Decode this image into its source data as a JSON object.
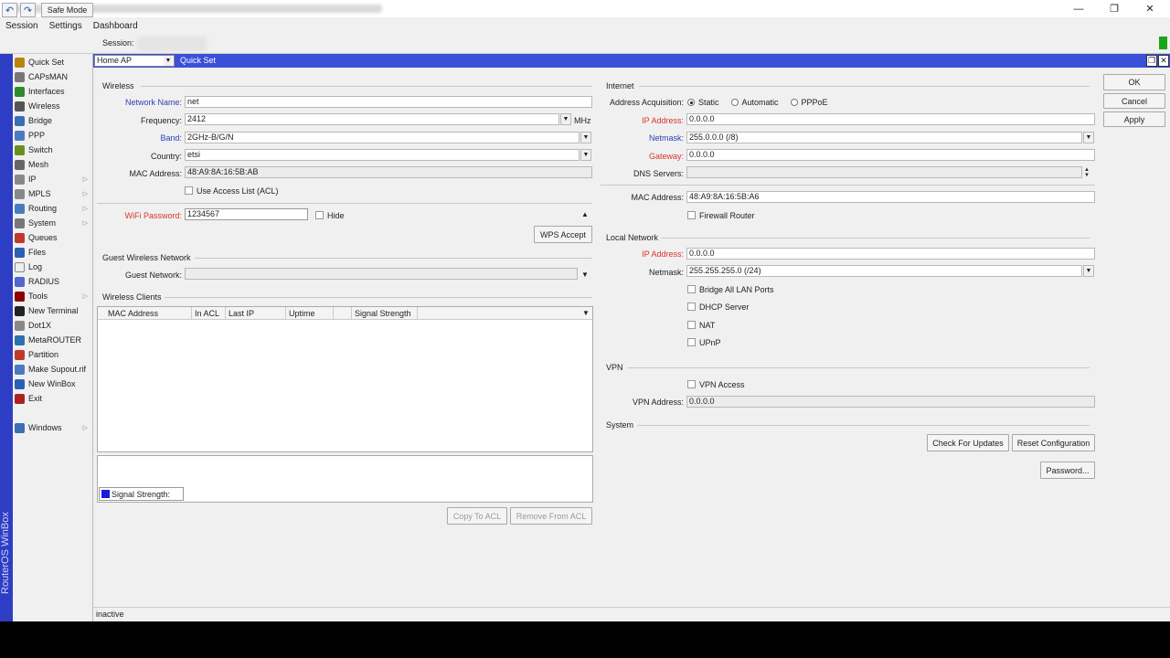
{
  "menu": [
    "Session",
    "Settings",
    "Dashboard"
  ],
  "toolbar": {
    "safe_mode": "Safe Mode",
    "session_label": "Session:"
  },
  "window_controls": {
    "minimize": "—",
    "maximize": "❐",
    "close": "✕"
  },
  "sidebar": {
    "vertical_label": "RouterOS WinBox",
    "items": [
      {
        "label": "Quick Set",
        "icon": "wand-icon",
        "color": "#b8860b",
        "sub": false
      },
      {
        "label": "CAPsMAN",
        "icon": "capsman-icon",
        "color": "#777777",
        "sub": false
      },
      {
        "label": "Interfaces",
        "icon": "interfaces-icon",
        "color": "#2e8b2e",
        "sub": false
      },
      {
        "label": "Wireless",
        "icon": "wireless-icon",
        "color": "#555555",
        "sub": false
      },
      {
        "label": "Bridge",
        "icon": "bridge-icon",
        "color": "#3a6fb0",
        "sub": false
      },
      {
        "label": "PPP",
        "icon": "ppp-icon",
        "color": "#4a7ac0",
        "sub": false
      },
      {
        "label": "Switch",
        "icon": "switch-icon",
        "color": "#6b8e23",
        "sub": false
      },
      {
        "label": "Mesh",
        "icon": "mesh-icon",
        "color": "#666666",
        "sub": false
      },
      {
        "label": "IP",
        "icon": "ip-icon",
        "color": "#888888",
        "sub": true
      },
      {
        "label": "MPLS",
        "icon": "mpls-icon",
        "color": "#888888",
        "sub": true
      },
      {
        "label": "Routing",
        "icon": "routing-icon",
        "color": "#4a7ac0",
        "sub": true
      },
      {
        "label": "System",
        "icon": "system-icon",
        "color": "#777777",
        "sub": true
      },
      {
        "label": "Queues",
        "icon": "queues-icon",
        "color": "#c0392b",
        "sub": false
      },
      {
        "label": "Files",
        "icon": "files-icon",
        "color": "#2b5fb4",
        "sub": false
      },
      {
        "label": "Log",
        "icon": "log-icon",
        "color": "#eeeeee",
        "sub": false
      },
      {
        "label": "RADIUS",
        "icon": "radius-icon",
        "color": "#5566cc",
        "sub": false
      },
      {
        "label": "Tools",
        "icon": "tools-icon",
        "color": "#8b0000",
        "sub": true
      },
      {
        "label": "New Terminal",
        "icon": "terminal-icon",
        "color": "#222222",
        "sub": false
      },
      {
        "label": "Dot1X",
        "icon": "dot1x-icon",
        "color": "#888888",
        "sub": false
      },
      {
        "label": "MetaROUTER",
        "icon": "metarouter-icon",
        "color": "#2e6fb0",
        "sub": false
      },
      {
        "label": "Partition",
        "icon": "partition-icon",
        "color": "#c0392b",
        "sub": false
      },
      {
        "label": "Make Supout.rif",
        "icon": "supout-icon",
        "color": "#4a7ac0",
        "sub": false
      },
      {
        "label": "New WinBox",
        "icon": "winbox-icon",
        "color": "#2b5fb4",
        "sub": false
      },
      {
        "label": "Exit",
        "icon": "exit-icon",
        "color": "#aa2222",
        "sub": false
      }
    ],
    "windows": {
      "label": "Windows",
      "icon": "windows-icon",
      "color": "#3a6fb0"
    }
  },
  "quickset": {
    "mode": "Home AP",
    "title": "Quick Set",
    "buttons": {
      "ok": "OK",
      "cancel": "Cancel",
      "apply": "Apply"
    }
  },
  "wireless": {
    "group": "Wireless",
    "network_name_label": "Network Name:",
    "network_name": "net",
    "frequency_label": "Frequency:",
    "frequency": "2412",
    "frequency_unit": "MHz",
    "band_label": "Band:",
    "band": "2GHz-B/G/N",
    "country_label": "Country:",
    "country": "etsi",
    "mac_label": "MAC Address:",
    "mac": "48:A9:8A:16:5B:AB",
    "acl_label": "Use Access List (ACL)",
    "wifi_password_label": "WiFi Password:",
    "wifi_password": "1234567",
    "hide_label": "Hide",
    "wps_button": "WPS Accept"
  },
  "guest": {
    "group": "Guest Wireless Network",
    "label": "Guest Network:",
    "value": ""
  },
  "clients": {
    "group": "Wireless Clients",
    "columns": [
      "MAC Address",
      "In ACL",
      "Last IP",
      "Uptime",
      "",
      "Signal Strength"
    ],
    "legend": "Signal Strength:",
    "legend_color": "#1a1adb",
    "copy_button": "Copy To ACL",
    "remove_button": "Remove From ACL"
  },
  "internet": {
    "group": "Internet",
    "acq_label": "Address Acquisition:",
    "acq_options": [
      "Static",
      "Automatic",
      "PPPoE"
    ],
    "ip_label": "IP Address:",
    "ip": "0.0.0.0",
    "netmask_label": "Netmask:",
    "netmask": "255.0.0.0 (/8)",
    "gateway_label": "Gateway:",
    "gateway": "0.0.0.0",
    "dns_label": "DNS Servers:",
    "dns": "",
    "mac_label": "MAC Address:",
    "mac": "48:A9:8A:16:5B:A6",
    "firewall_label": "Firewall Router"
  },
  "local": {
    "group": "Local Network",
    "ip_label": "IP Address:",
    "ip": "0.0.0.0",
    "netmask_label": "Netmask:",
    "netmask": "255.255.255.0 (/24)",
    "bridge_label": "Bridge All LAN Ports",
    "dhcp_label": "DHCP Server",
    "nat_label": "NAT",
    "upnp_label": "UPnP"
  },
  "vpn": {
    "group": "VPN",
    "access_label": "VPN Access",
    "address_label": "VPN Address:",
    "address": "0.0.0.0"
  },
  "system": {
    "group": "System",
    "check_updates": "Check For Updates",
    "reset": "Reset Configuration",
    "password": "Password..."
  },
  "status": "inactive"
}
